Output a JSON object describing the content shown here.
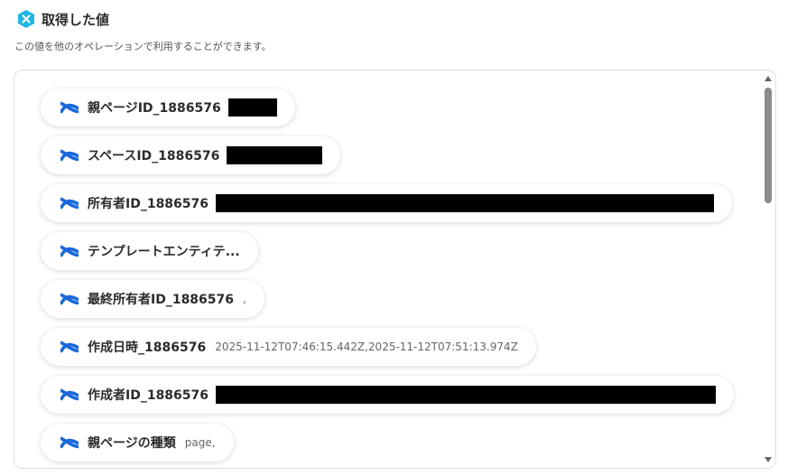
{
  "header": {
    "title": "取得した値",
    "description": "この値を他のオペレーションで利用することができます。",
    "icon": "yoom-hex-icon",
    "icon_color": "#1fb6e3"
  },
  "items": [
    {
      "label": "親ページID_1886576",
      "value": "",
      "redacted": true
    },
    {
      "label": "スペースID_1886576",
      "value": "",
      "redacted": true
    },
    {
      "label": "所有者ID_1886576",
      "value": "",
      "redacted": true
    },
    {
      "label": "テンプレートエンティテ...",
      "value": "",
      "redacted": false
    },
    {
      "label": "最終所有者ID_1886576",
      "value": ",",
      "redacted": false
    },
    {
      "label": "作成日時_1886576",
      "value": "2025-11-12T07:46:15.442Z,2025-11-12T07:51:13.974Z",
      "redacted": false
    },
    {
      "label": "作成者ID_1886576",
      "value": "",
      "redacted": true
    },
    {
      "label": "親ページの種類",
      "value": "page,",
      "redacted": false
    }
  ],
  "item_icon": "confluence-icon",
  "item_icon_color": "#1868db"
}
